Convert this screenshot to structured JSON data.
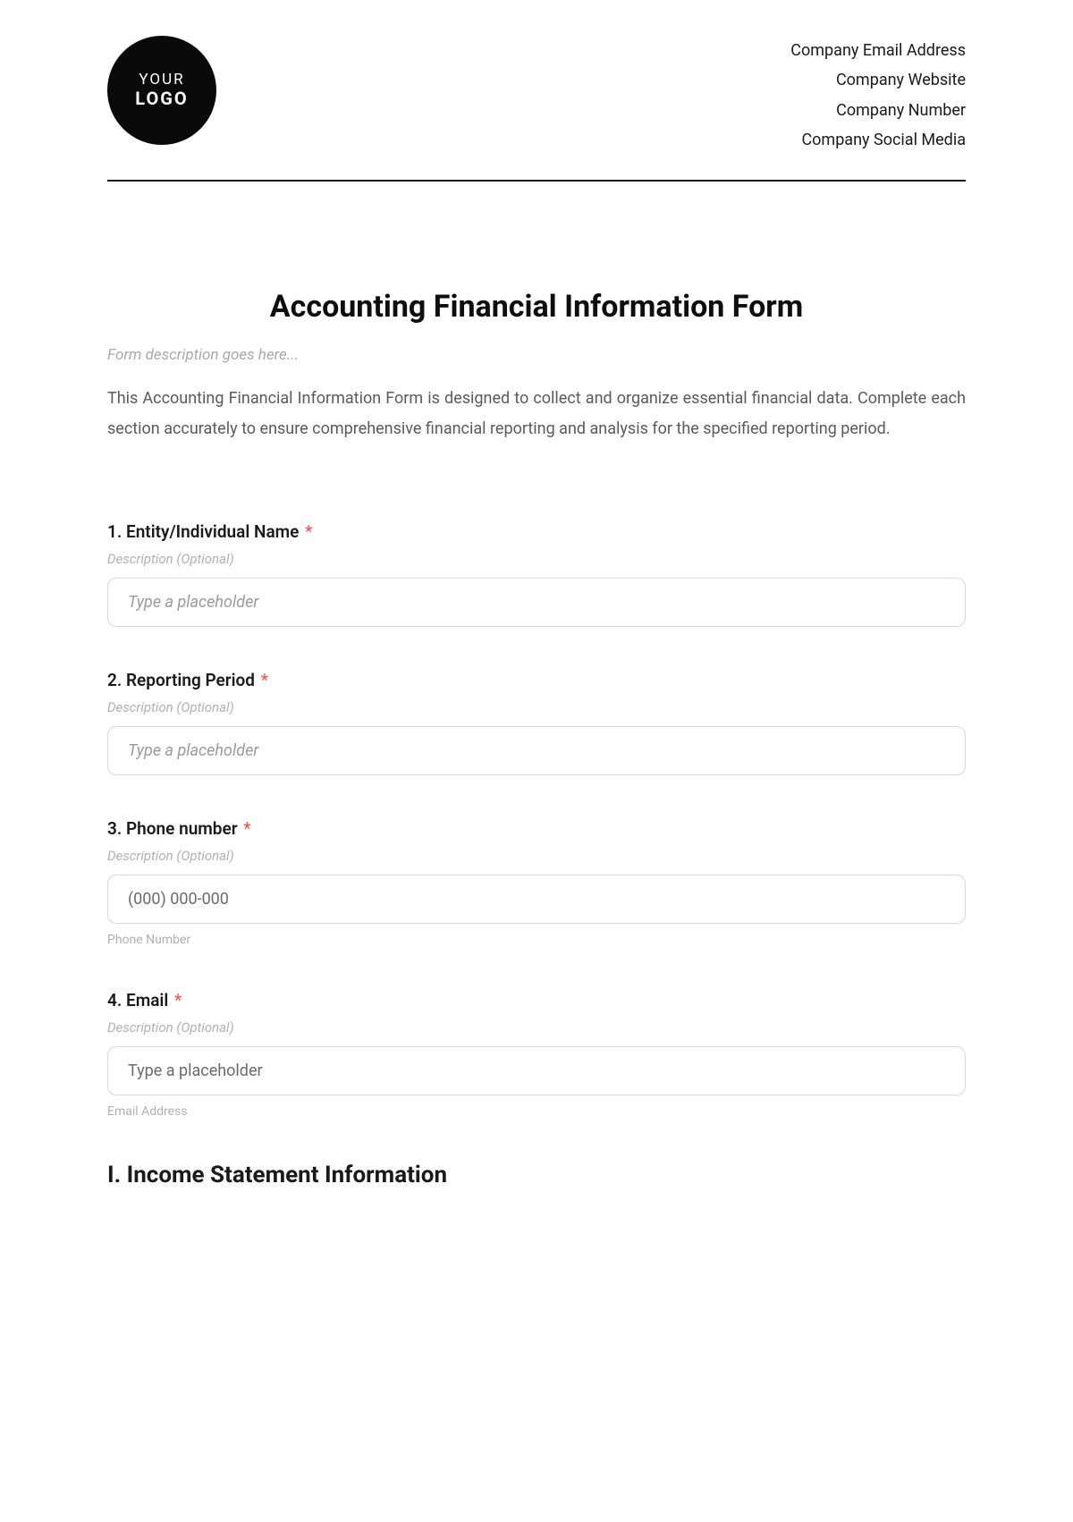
{
  "header": {
    "logo": {
      "line1": "YOUR",
      "line2": "LOGO"
    },
    "company_info": [
      "Company Email Address",
      "Company Website",
      "Company Number",
      "Company Social Media"
    ]
  },
  "form": {
    "title": "Accounting Financial Information Form",
    "description_placeholder": "Form description goes here...",
    "intro": "This Accounting Financial Information Form is designed to collect and organize essential financial data. Complete each section accurately to ensure comprehensive financial reporting and analysis for the specified reporting period."
  },
  "fields": [
    {
      "label": "1. Entity/Individual Name",
      "required_mark": "*",
      "description": "Description (Optional)",
      "placeholder": "Type a placeholder",
      "helper": "",
      "italic": true
    },
    {
      "label": "2. Reporting Period",
      "required_mark": "*",
      "description": "Description (Optional)",
      "placeholder": "Type a placeholder",
      "helper": "",
      "italic": true
    },
    {
      "label": "3. Phone number",
      "required_mark": "*",
      "description": "Description (Optional)",
      "placeholder": "(000) 000-000",
      "helper": "Phone Number",
      "italic": false
    },
    {
      "label": "4. Email",
      "required_mark": "*",
      "description": "Description (Optional)",
      "placeholder": "Type a placeholder",
      "helper": "Email Address",
      "italic": false
    }
  ],
  "section": {
    "heading": "I. Income Statement Information"
  }
}
